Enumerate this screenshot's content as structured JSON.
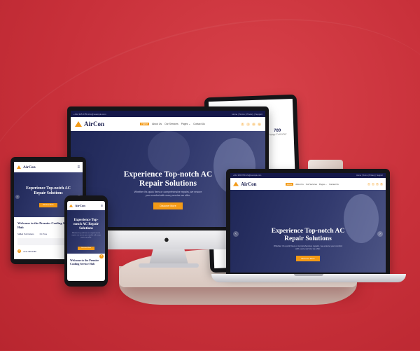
{
  "site": {
    "brand": "AirCon",
    "topbar_left": "+012 345 6789   info@example.com",
    "topbar_right": "Home | Terms | Privacy | Support",
    "menu": [
      {
        "label": "Home",
        "active": true
      },
      {
        "label": "About Us",
        "active": false
      },
      {
        "label": "Our Services",
        "active": false
      },
      {
        "label": "Pages ⌄",
        "active": false
      },
      {
        "label": "Contact Us",
        "active": false
      }
    ],
    "social": [
      "f",
      "t",
      "in",
      "ig"
    ],
    "hero_title": "Experience Top-notch AC Repair Solutions",
    "hero_text": "Whether it's quick fixes or comprehensive repairs, we ensure your comfort with every service we offer.",
    "hero_button": "Discover More",
    "welcome_title": "Welcome to the Premier Cooling Service Hub",
    "feature_1": "Skilled Technicians",
    "feature_2": "On Time",
    "stat_value": "789",
    "stat_label": "Happy Customer",
    "phone_short": "+012 345 6789",
    "badge": "Satisfaction"
  },
  "colors": {
    "accent": "#f39a16",
    "navy": "#15184a",
    "background": "#c8303a"
  },
  "icons": {
    "apple_logo": "apple-logo-icon",
    "prev": "chevron-left-icon",
    "next": "chevron-right-icon"
  }
}
